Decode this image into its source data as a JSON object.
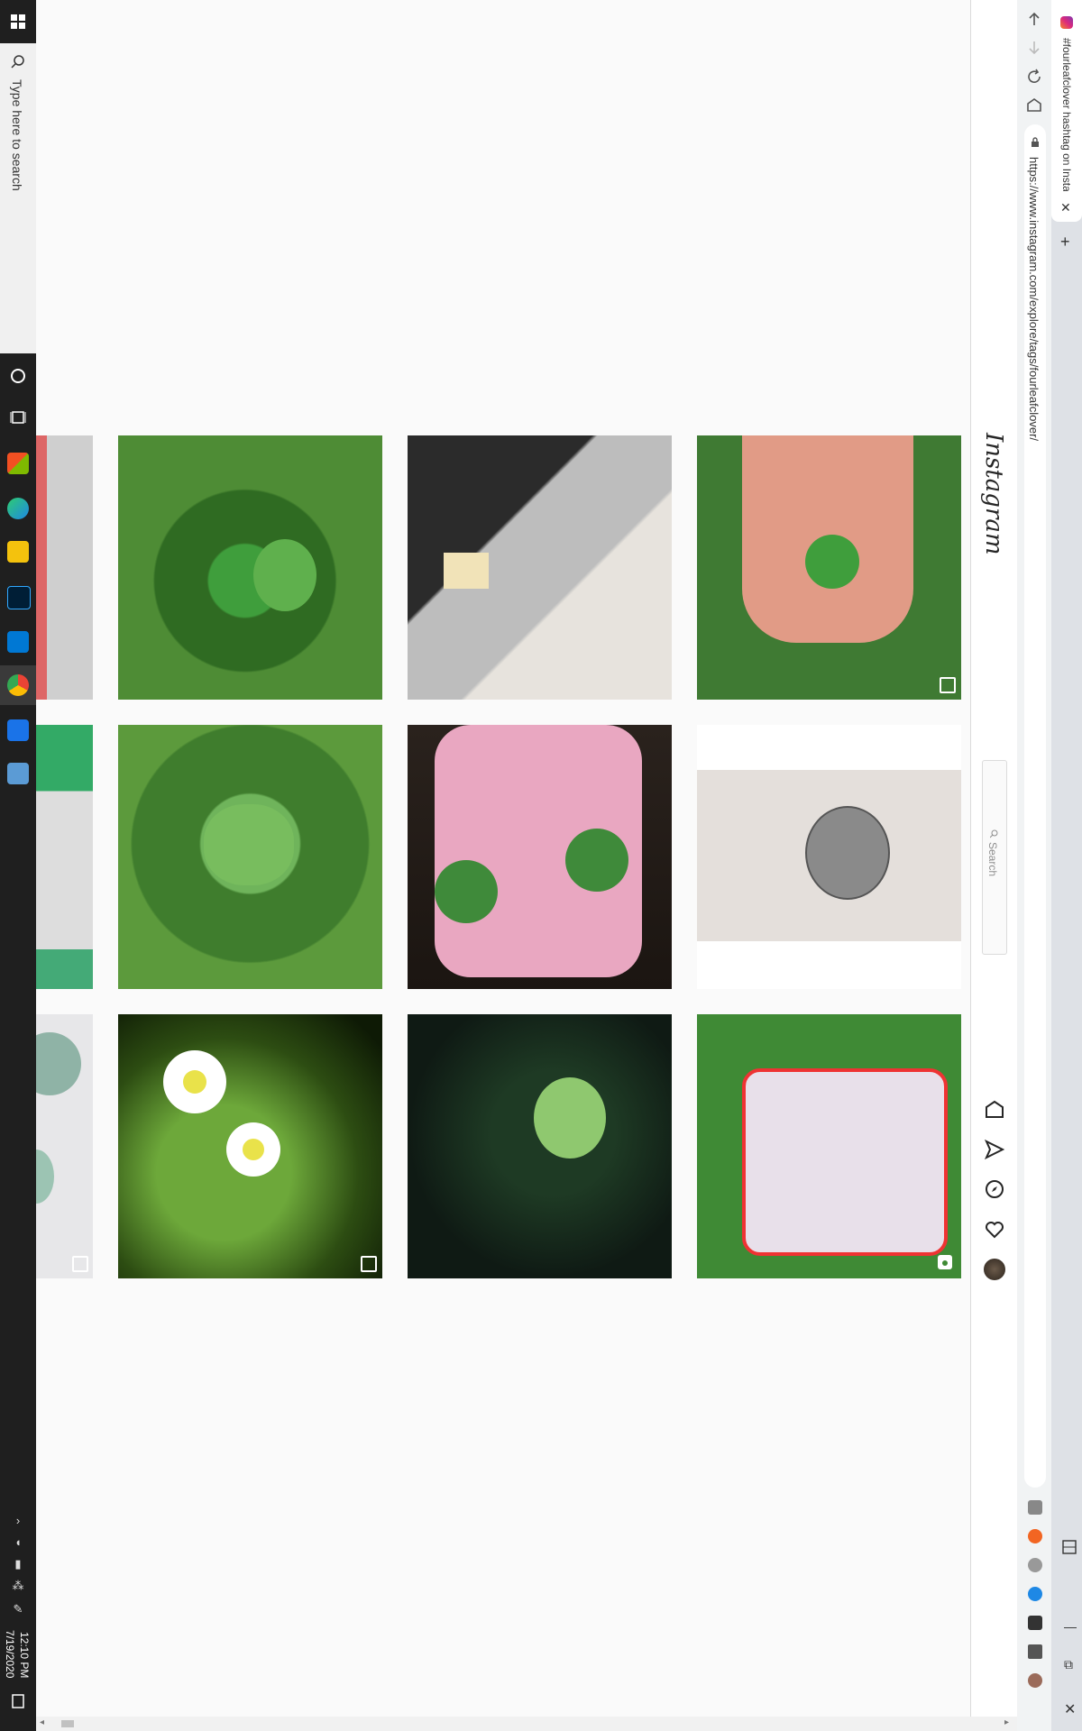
{
  "taskbar": {
    "search_placeholder": "Type here to search",
    "clock_time": "12:10 PM",
    "clock_date": "7/19/2020"
  },
  "browser": {
    "tab_title": "#fourleafclover hashtag on Insta",
    "url": "https://www.instagram.com/explore/tags/fourleafclover/"
  },
  "instagram": {
    "logo": "Instagram",
    "search_placeholder": "Search"
  },
  "grid": {
    "posts": [
      {
        "desc": "partial photo",
        "type": ""
      },
      {
        "desc": "clover in grass",
        "type": ""
      },
      {
        "desc": "gothic window shadow",
        "type": ""
      },
      {
        "desc": "clover held between fingers",
        "type": "multiple"
      },
      {
        "desc": "partial white cat",
        "type": ""
      },
      {
        "desc": "clover leaves in grass",
        "type": ""
      },
      {
        "desc": "two clovers on palm",
        "type": ""
      },
      {
        "desc": "clover tattoo on arm",
        "type": ""
      },
      {
        "desc": "partial clover",
        "type": "multiple"
      },
      {
        "desc": "daisies with clover",
        "type": "multiple"
      },
      {
        "desc": "clover in dark grass",
        "type": ""
      },
      {
        "desc": "face mask on clovers",
        "type": "video"
      }
    ]
  },
  "colors": {
    "taskbar": "#1f1f1f",
    "page_bg": "#fafafa",
    "chrome_bg": "#f1f3f4"
  }
}
